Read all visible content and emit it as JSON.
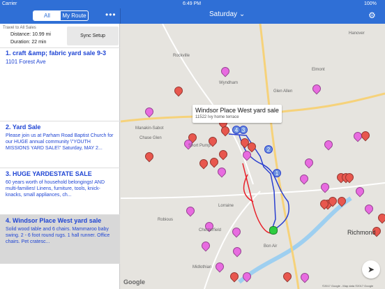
{
  "status_bar": {
    "carrier": "Carrier",
    "time": "6:49 PM",
    "battery": "100%"
  },
  "header": {
    "tab_all": "All",
    "tab_my_route": "My Route",
    "more_icon": "ellipsis-icon",
    "day": "Saturday",
    "day_caret": "⌄",
    "gear_icon": "gear-icon"
  },
  "summary": {
    "title": "Travel to All Sales",
    "distance": "Distance: 10.99 mi",
    "duration": "Duration: 22 min",
    "sync_label": "Sync Setup"
  },
  "sales": [
    {
      "title": "1. craft &amp; fabric yard sale 9-3",
      "desc": "1101 Forest Ave"
    },
    {
      "title": "2. Yard Sale",
      "desc": "Please join us at Parham Road Baptist Church for our HUGE annual community \\\"YOUTH MISSIONS YARD SALE\\\"  Saturday, MAY 2..."
    },
    {
      "title": "3. HUGE YARDESTATE SALE",
      "desc": "60 years worth of household belongings! AND multi-families! Linens, furniture, tools, knick-knacks, small appliances, ch..."
    },
    {
      "title": "4. Windsor Place West yard sale",
      "desc": "Solid wood table and 6 chairs. Mammaroo baby swing.  2 - 6 foot round rugs. 1 hall runner.  Office chairs.  Pet cratesc..."
    }
  ],
  "map": {
    "places": [
      "Rockville",
      "Wyndham",
      "Glen Allen",
      "Elmont",
      "Manakin-Sabot",
      "Short Pump",
      "Chase Glen",
      "Lorraine",
      "Chesterfield",
      "Bon Air",
      "Richmond",
      "Midlothian",
      "Robious",
      "Hanover"
    ],
    "callout_title": "Windsor Place West yard sale",
    "callout_sub": "11522 Ivy home terrace",
    "route_labels": [
      "1",
      "2",
      "3",
      "4"
    ],
    "google": "Google",
    "copyright": "©2017 Google - Map data ©2017 Google",
    "locate_icon": "location-arrow-icon",
    "colors": {
      "nav": "#2f6fd6",
      "pin_pink": "#e86be0",
      "pin_red": "#e8574e",
      "route_blue": "#2a3fd0",
      "route_red": "#e8202a",
      "water": "#9ecff0"
    }
  }
}
